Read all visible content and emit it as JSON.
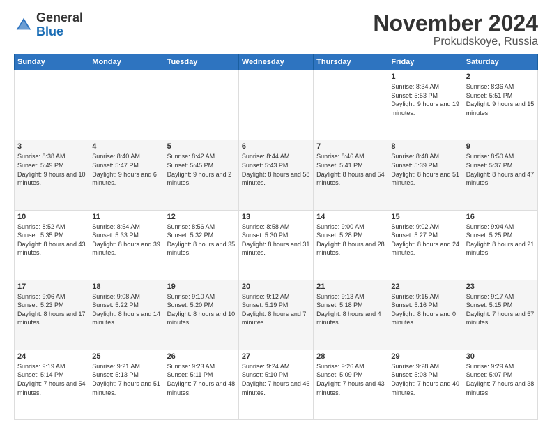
{
  "header": {
    "logo_general": "General",
    "logo_blue": "Blue",
    "month_title": "November 2024",
    "location": "Prokudskoye, Russia"
  },
  "days_of_week": [
    "Sunday",
    "Monday",
    "Tuesday",
    "Wednesday",
    "Thursday",
    "Friday",
    "Saturday"
  ],
  "weeks": [
    [
      {
        "day": "",
        "content": ""
      },
      {
        "day": "",
        "content": ""
      },
      {
        "day": "",
        "content": ""
      },
      {
        "day": "",
        "content": ""
      },
      {
        "day": "",
        "content": ""
      },
      {
        "day": "1",
        "content": "Sunrise: 8:34 AM\nSunset: 5:53 PM\nDaylight: 9 hours and 19 minutes."
      },
      {
        "day": "2",
        "content": "Sunrise: 8:36 AM\nSunset: 5:51 PM\nDaylight: 9 hours and 15 minutes."
      }
    ],
    [
      {
        "day": "3",
        "content": "Sunrise: 8:38 AM\nSunset: 5:49 PM\nDaylight: 9 hours and 10 minutes."
      },
      {
        "day": "4",
        "content": "Sunrise: 8:40 AM\nSunset: 5:47 PM\nDaylight: 9 hours and 6 minutes."
      },
      {
        "day": "5",
        "content": "Sunrise: 8:42 AM\nSunset: 5:45 PM\nDaylight: 9 hours and 2 minutes."
      },
      {
        "day": "6",
        "content": "Sunrise: 8:44 AM\nSunset: 5:43 PM\nDaylight: 8 hours and 58 minutes."
      },
      {
        "day": "7",
        "content": "Sunrise: 8:46 AM\nSunset: 5:41 PM\nDaylight: 8 hours and 54 minutes."
      },
      {
        "day": "8",
        "content": "Sunrise: 8:48 AM\nSunset: 5:39 PM\nDaylight: 8 hours and 51 minutes."
      },
      {
        "day": "9",
        "content": "Sunrise: 8:50 AM\nSunset: 5:37 PM\nDaylight: 8 hours and 47 minutes."
      }
    ],
    [
      {
        "day": "10",
        "content": "Sunrise: 8:52 AM\nSunset: 5:35 PM\nDaylight: 8 hours and 43 minutes."
      },
      {
        "day": "11",
        "content": "Sunrise: 8:54 AM\nSunset: 5:33 PM\nDaylight: 8 hours and 39 minutes."
      },
      {
        "day": "12",
        "content": "Sunrise: 8:56 AM\nSunset: 5:32 PM\nDaylight: 8 hours and 35 minutes."
      },
      {
        "day": "13",
        "content": "Sunrise: 8:58 AM\nSunset: 5:30 PM\nDaylight: 8 hours and 31 minutes."
      },
      {
        "day": "14",
        "content": "Sunrise: 9:00 AM\nSunset: 5:28 PM\nDaylight: 8 hours and 28 minutes."
      },
      {
        "day": "15",
        "content": "Sunrise: 9:02 AM\nSunset: 5:27 PM\nDaylight: 8 hours and 24 minutes."
      },
      {
        "day": "16",
        "content": "Sunrise: 9:04 AM\nSunset: 5:25 PM\nDaylight: 8 hours and 21 minutes."
      }
    ],
    [
      {
        "day": "17",
        "content": "Sunrise: 9:06 AM\nSunset: 5:23 PM\nDaylight: 8 hours and 17 minutes."
      },
      {
        "day": "18",
        "content": "Sunrise: 9:08 AM\nSunset: 5:22 PM\nDaylight: 8 hours and 14 minutes."
      },
      {
        "day": "19",
        "content": "Sunrise: 9:10 AM\nSunset: 5:20 PM\nDaylight: 8 hours and 10 minutes."
      },
      {
        "day": "20",
        "content": "Sunrise: 9:12 AM\nSunset: 5:19 PM\nDaylight: 8 hours and 7 minutes."
      },
      {
        "day": "21",
        "content": "Sunrise: 9:13 AM\nSunset: 5:18 PM\nDaylight: 8 hours and 4 minutes."
      },
      {
        "day": "22",
        "content": "Sunrise: 9:15 AM\nSunset: 5:16 PM\nDaylight: 8 hours and 0 minutes."
      },
      {
        "day": "23",
        "content": "Sunrise: 9:17 AM\nSunset: 5:15 PM\nDaylight: 7 hours and 57 minutes."
      }
    ],
    [
      {
        "day": "24",
        "content": "Sunrise: 9:19 AM\nSunset: 5:14 PM\nDaylight: 7 hours and 54 minutes."
      },
      {
        "day": "25",
        "content": "Sunrise: 9:21 AM\nSunset: 5:13 PM\nDaylight: 7 hours and 51 minutes."
      },
      {
        "day": "26",
        "content": "Sunrise: 9:23 AM\nSunset: 5:11 PM\nDaylight: 7 hours and 48 minutes."
      },
      {
        "day": "27",
        "content": "Sunrise: 9:24 AM\nSunset: 5:10 PM\nDaylight: 7 hours and 46 minutes."
      },
      {
        "day": "28",
        "content": "Sunrise: 9:26 AM\nSunset: 5:09 PM\nDaylight: 7 hours and 43 minutes."
      },
      {
        "day": "29",
        "content": "Sunrise: 9:28 AM\nSunset: 5:08 PM\nDaylight: 7 hours and 40 minutes."
      },
      {
        "day": "30",
        "content": "Sunrise: 9:29 AM\nSunset: 5:07 PM\nDaylight: 7 hours and 38 minutes."
      }
    ]
  ]
}
